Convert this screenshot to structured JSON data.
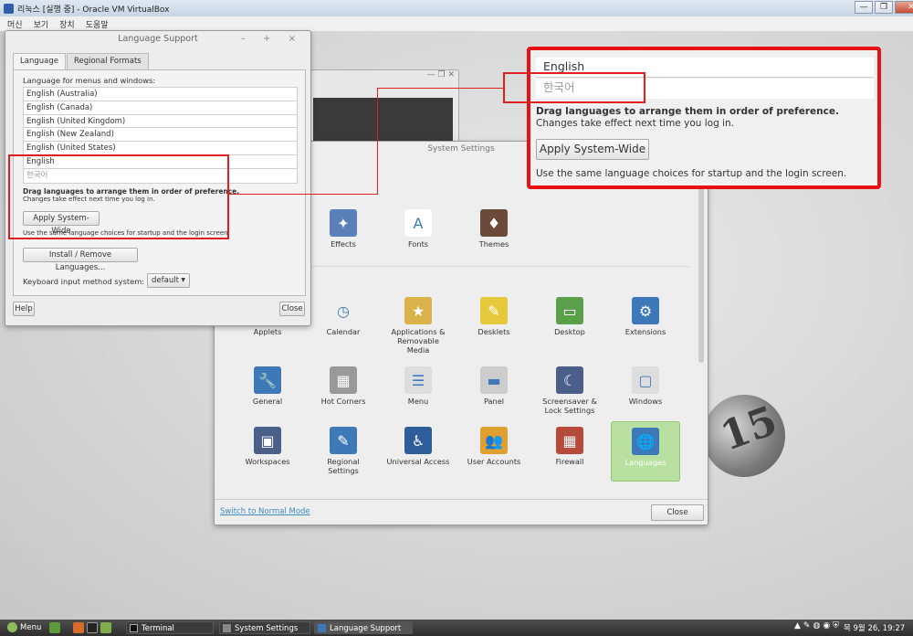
{
  "vbox": {
    "title": "리눅스 [실행 중] - Oracle VM VirtualBox",
    "menu": [
      "머신",
      "보기",
      "장치",
      "도움말"
    ],
    "win_controls": [
      "—",
      "❐",
      "✕"
    ]
  },
  "desktop": {
    "logo_text": "15"
  },
  "system_settings": {
    "title": "System Settings",
    "items": [
      {
        "label": "Effects",
        "icon": "effects-icon",
        "color": "#5b7fb8",
        "glyph": "✦"
      },
      {
        "label": "Fonts",
        "icon": "fonts-icon",
        "color": "#ffffff",
        "glyph": "A"
      },
      {
        "label": "Themes",
        "icon": "themes-icon",
        "color": "#6b4a3a",
        "glyph": "♦"
      },
      {
        "label": "Applets",
        "icon": "applets-icon",
        "color": "#888888",
        "glyph": ""
      },
      {
        "label": "Calendar",
        "icon": "calendar-icon",
        "color": "#eeeeee",
        "glyph": "◷"
      },
      {
        "label": "Applications &\nRemovable\nMedia",
        "icon": "applications-icon",
        "color": "#d9b24a",
        "glyph": "★"
      },
      {
        "label": "Desklets",
        "icon": "desklets-icon",
        "color": "#e6c93a",
        "glyph": "✎"
      },
      {
        "label": "Desktop",
        "icon": "desktop-icon",
        "color": "#5aa04a",
        "glyph": "▭"
      },
      {
        "label": "Extensions",
        "icon": "extensions-icon",
        "color": "#3d78b8",
        "glyph": "⚙"
      },
      {
        "label": "General",
        "icon": "general-icon",
        "color": "#3d78b8",
        "glyph": "🔧"
      },
      {
        "label": "Hot Corners",
        "icon": "hot-corners-icon",
        "color": "#999999",
        "glyph": "▦"
      },
      {
        "label": "Menu",
        "icon": "menu-icon",
        "color": "#dddddd",
        "glyph": "☰"
      },
      {
        "label": "Panel",
        "icon": "panel-icon",
        "color": "#cccccc",
        "glyph": "▬"
      },
      {
        "label": "Screensaver &\nLock Settings",
        "icon": "screensaver-icon",
        "color": "#4a5f8a",
        "glyph": "☾"
      },
      {
        "label": "Windows",
        "icon": "windows-icon",
        "color": "#dddddd",
        "glyph": "▢"
      },
      {
        "label": "Workspaces",
        "icon": "workspaces-icon",
        "color": "#4a5f8a",
        "glyph": "▣"
      },
      {
        "label": "Regional\nSettings",
        "icon": "regional-settings-icon",
        "color": "#3d78b8",
        "glyph": "✎"
      },
      {
        "label": "Universal Access",
        "icon": "universal-access-icon",
        "color": "#2e5d9a",
        "glyph": "♿"
      },
      {
        "label": "User Accounts",
        "icon": "user-accounts-icon",
        "color": "#e0a030",
        "glyph": "👥"
      },
      {
        "label": "Firewall",
        "icon": "firewall-icon",
        "color": "#b84a3a",
        "glyph": "▦"
      },
      {
        "label": "Languages",
        "icon": "languages-icon",
        "color": "#3d78b8",
        "glyph": "🌐"
      }
    ],
    "normal_mode_link": "Switch to Normal Mode",
    "close_label": "Close"
  },
  "language_support": {
    "title": "Language Support",
    "controls": "– + ×",
    "tabs": [
      "Language",
      "Regional Formats"
    ],
    "list_label": "Language for menus and windows:",
    "languages": [
      "English (Australia)",
      "English (Canada)",
      "English (United Kingdom)",
      "English (New Zealand)",
      "English (United States)",
      "English",
      "한국어"
    ],
    "drag_hint": "Drag languages to arrange them in order of preference.",
    "changes_hint": "Changes take effect next time you log in.",
    "apply_label": "Apply System-Wide",
    "apply_hint": "Use the same language choices for startup and the login screen.",
    "install_label": "Install / Remove Languages...",
    "keyboard_label": "Keyboard input method system:",
    "keyboard_value": "default",
    "help_label": "Help",
    "close_label": "Close"
  },
  "zoom": {
    "english": "English",
    "korean": "한국어",
    "drag_hint": "Drag languages to arrange them in order of preference.",
    "changes_hint": "Changes take effect next time you log in.",
    "apply_label": "Apply System-Wide",
    "apply_hint": "Use the same language choices for startup and the login screen."
  },
  "taskbar": {
    "menu_label": "Menu",
    "windows": [
      "Terminal",
      "System Settings",
      "Language Support"
    ],
    "clock": "목 9월 26, 19:27"
  }
}
